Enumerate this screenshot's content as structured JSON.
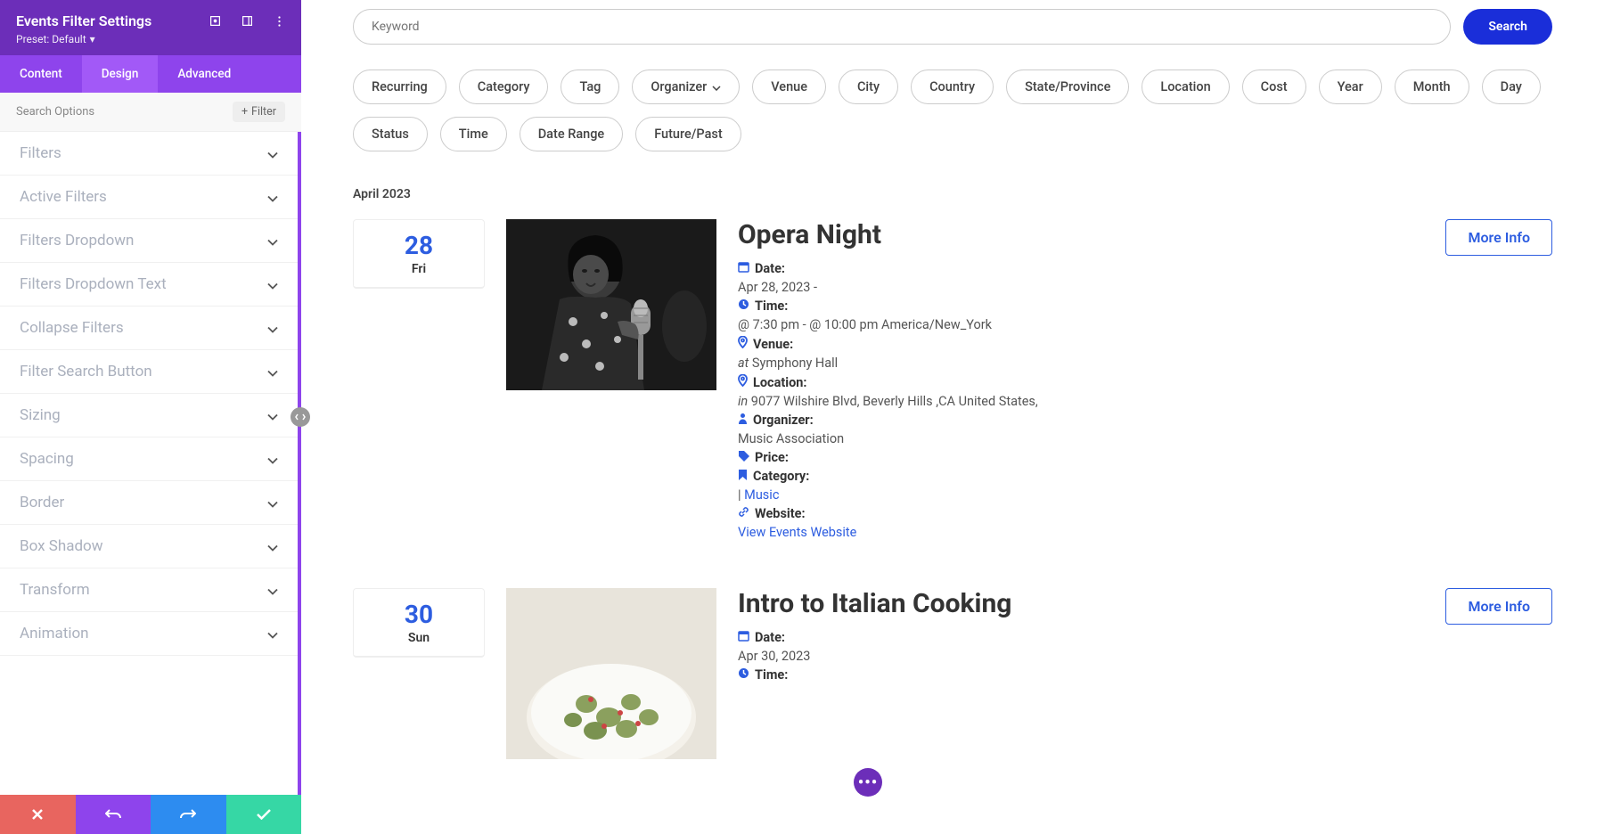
{
  "settings_panel": {
    "title": "Events Filter Settings",
    "preset_label": "Preset: Default",
    "tabs": [
      "Content",
      "Design",
      "Advanced"
    ],
    "active_tab": "Design",
    "search_options_label": "Search Options",
    "filter_button_label": "Filter",
    "accordion_items": [
      "Filters",
      "Active Filters",
      "Filters Dropdown",
      "Filters Dropdown Text",
      "Collapse Filters",
      "Filter Search Button",
      "Sizing",
      "Spacing",
      "Border",
      "Box Shadow",
      "Transform",
      "Animation"
    ]
  },
  "preview": {
    "search_placeholder": "Keyword",
    "search_button": "Search",
    "filter_pills": [
      {
        "label": "Recurring",
        "has_dropdown": false
      },
      {
        "label": "Category",
        "has_dropdown": false
      },
      {
        "label": "Tag",
        "has_dropdown": false
      },
      {
        "label": "Organizer",
        "has_dropdown": true
      },
      {
        "label": "Venue",
        "has_dropdown": false
      },
      {
        "label": "City",
        "has_dropdown": false
      },
      {
        "label": "Country",
        "has_dropdown": false
      },
      {
        "label": "State/Province",
        "has_dropdown": false
      },
      {
        "label": "Location",
        "has_dropdown": false
      },
      {
        "label": "Cost",
        "has_dropdown": false
      },
      {
        "label": "Year",
        "has_dropdown": false
      },
      {
        "label": "Month",
        "has_dropdown": false
      },
      {
        "label": "Day",
        "has_dropdown": false
      },
      {
        "label": "Status",
        "has_dropdown": false
      },
      {
        "label": "Time",
        "has_dropdown": false
      },
      {
        "label": "Date Range",
        "has_dropdown": false
      },
      {
        "label": "Future/Past",
        "has_dropdown": false
      }
    ],
    "month_label": "April 2023",
    "events": [
      {
        "date_num": "28",
        "date_day": "Fri",
        "title": "Opera Night",
        "date_label": "Date:",
        "date_value": "Apr 28, 2023 -",
        "time_label": "Time:",
        "time_value": "@ 7:30 pm - @ 10:00 pm America/New_York",
        "venue_label": "Venue:",
        "venue_prefix": "at",
        "venue_value": "Symphony Hall",
        "location_label": "Location:",
        "location_prefix": "in",
        "location_value": "9077 Wilshire Blvd, Beverly Hills ,CA United States,",
        "organizer_label": "Organizer:",
        "organizer_value": "Music Association",
        "price_label": "Price:",
        "category_label": "Category:",
        "category_prefix": "|",
        "category_link": "Music",
        "website_label": "Website:",
        "website_link": "View Events Website",
        "more_info": "More Info"
      },
      {
        "date_num": "30",
        "date_day": "Sun",
        "title": "Intro to Italian Cooking",
        "date_label": "Date:",
        "date_value": "Apr 30, 2023",
        "time_label": "Time:",
        "more_info": "More Info"
      }
    ]
  }
}
